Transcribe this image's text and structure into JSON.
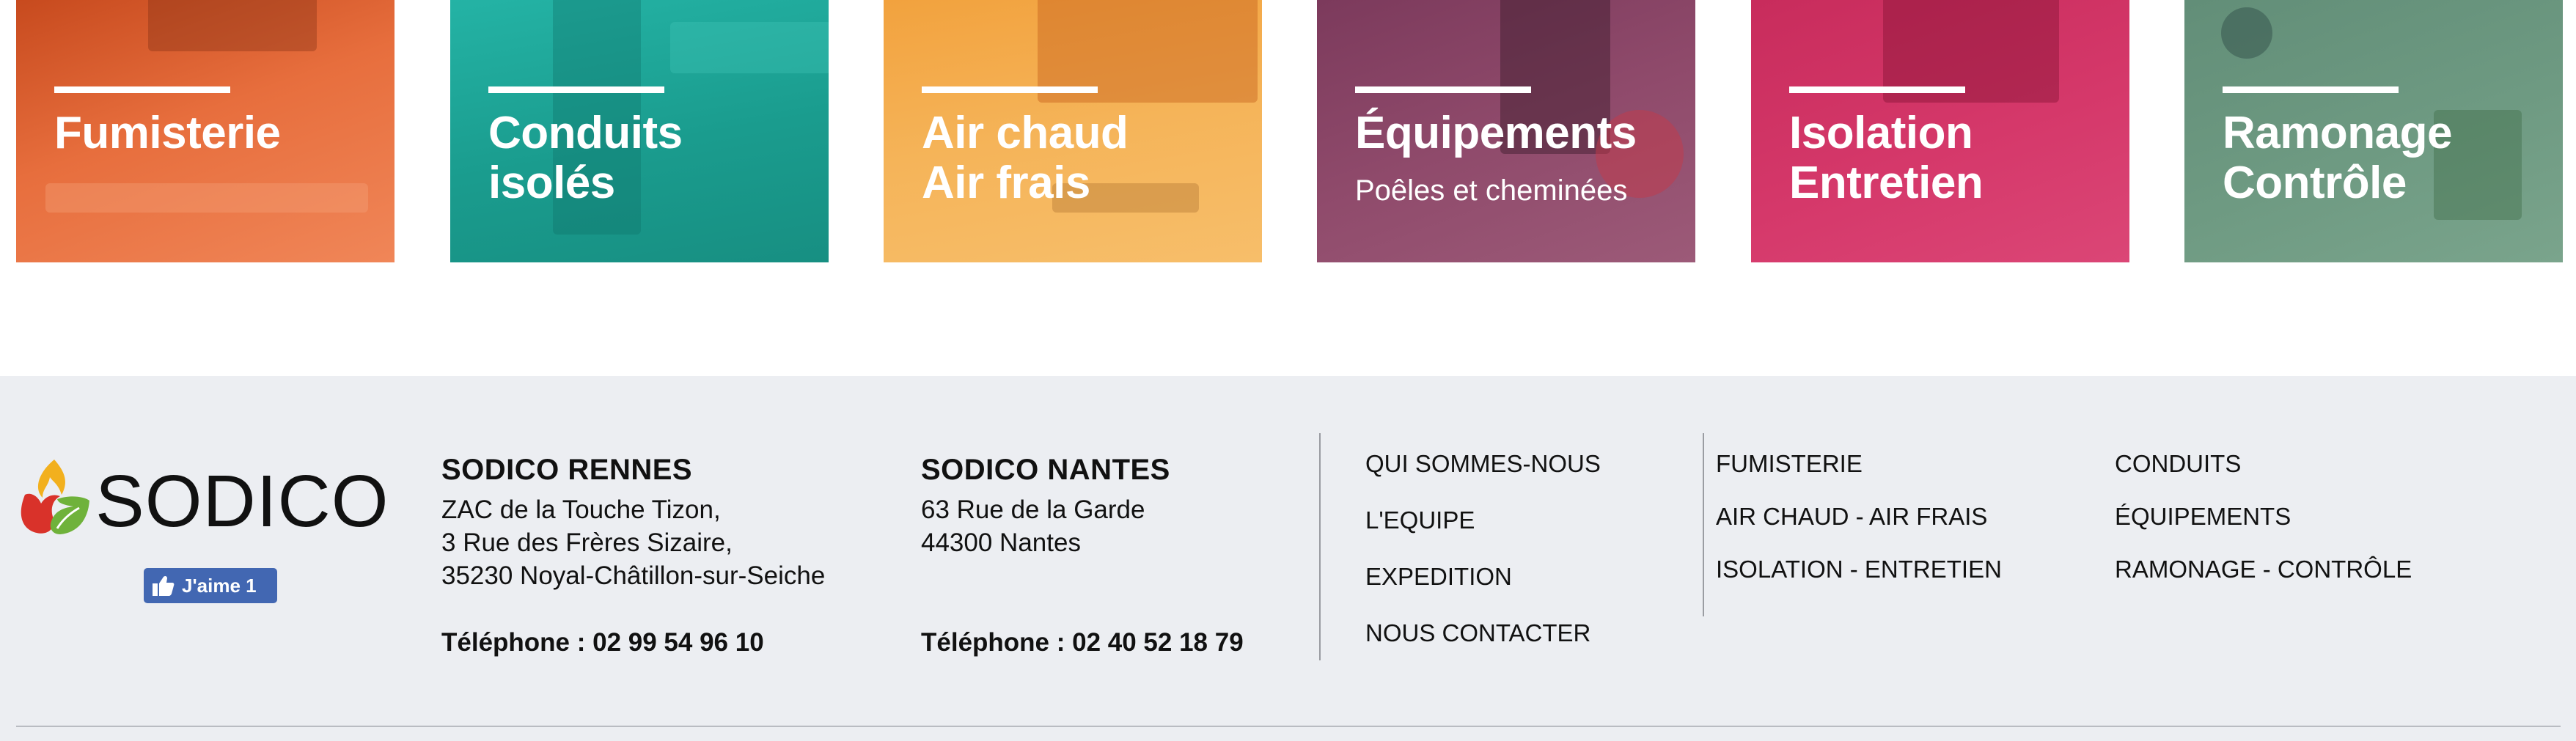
{
  "tiles": [
    {
      "id": "fumisterie",
      "lines": [
        "Fumisterie"
      ],
      "subtitle": "",
      "color": "#e46a3a"
    },
    {
      "id": "conduits",
      "lines": [
        "Conduits",
        "isolés"
      ],
      "subtitle": "",
      "color": "#1fa99a"
    },
    {
      "id": "air",
      "lines": [
        "Air chaud",
        "Air frais"
      ],
      "subtitle": "",
      "color": "#f4b054"
    },
    {
      "id": "equipements",
      "lines": [
        "Équipements"
      ],
      "subtitle": "Poêles et cheminées",
      "color": "#8e4a6a"
    },
    {
      "id": "isolation",
      "lines": [
        "Isolation",
        "Entretien"
      ],
      "subtitle": "",
      "color": "#d5386a"
    },
    {
      "id": "ramonage",
      "lines": [
        "Ramonage",
        "Contrôle"
      ],
      "subtitle": "",
      "color": "#6e9a82"
    }
  ],
  "footer": {
    "logo_text": "SODICO",
    "facebook_like": "J'aime 1",
    "rennes": {
      "name": "SODICO RENNES",
      "address": [
        "ZAC de la Touche Tizon,",
        "3 Rue des Frères Sizaire,",
        "35230 Noyal-Châtillon-sur-Seiche"
      ],
      "phone": "Téléphone : 02 99 54 96 10"
    },
    "nantes": {
      "name": "SODICO NANTES",
      "address": [
        "63 Rue de la Garde",
        "44300 Nantes"
      ],
      "phone": "Téléphone : 02 40 52 18 79"
    },
    "menu_company": [
      "QUI SOMMES-NOUS",
      "L'EQUIPE",
      "EXPEDITION",
      "NOUS CONTACTER"
    ],
    "menu_products_1": [
      "FUMISTERIE",
      "AIR CHAUD - AIR FRAIS",
      "ISOLATION - ENTRETIEN"
    ],
    "menu_products_2": [
      "CONDUITS",
      "ÉQUIPEMENTS",
      "RAMONAGE - CONTRÔLE"
    ]
  },
  "colors": {
    "footer_bg": "#eceef2",
    "facebook": "#4267b2",
    "logo_red": "#d9322a",
    "logo_yellow": "#f2b01e",
    "logo_green": "#6fb23b"
  }
}
